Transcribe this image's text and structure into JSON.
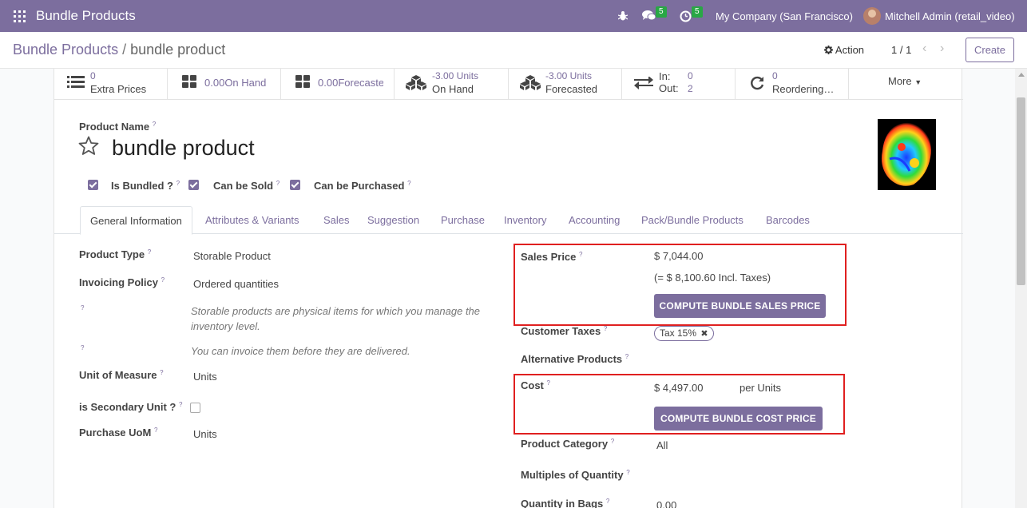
{
  "navbar": {
    "app_title": "Bundle Products",
    "chat_badge": "5",
    "activity_badge": "5",
    "company": "My Company (San Francisco)",
    "user": "Mitchell Admin (retail_video)"
  },
  "control": {
    "breadcrumb_parent": "Bundle Products",
    "breadcrumb_separator": "/",
    "breadcrumb_current": "bundle product",
    "action_label": "Action",
    "pager": "1 / 1",
    "create_label": "Create"
  },
  "smart_buttons": [
    {
      "value": "0",
      "label": "Extra Prices",
      "icon": "list-icon"
    },
    {
      "value": "0.00",
      "label": "On Hand",
      "icon": "grid-icon"
    },
    {
      "value": "0.00",
      "label": "Forecasted",
      "icon": "grid-icon"
    },
    {
      "value": "-3.00 Units",
      "label": "On Hand",
      "icon": "cubes-icon"
    },
    {
      "value": "-3.00 Units",
      "label": "Forecasted",
      "icon": "cubes-icon"
    },
    {
      "in_label": "In:",
      "in_value": "0",
      "out_label": "Out:",
      "out_value": "2",
      "icon": "exchange-icon"
    },
    {
      "value": "0",
      "label": "Reordering…",
      "icon": "refresh-icon"
    }
  ],
  "more_label": "More",
  "product": {
    "name_label": "Product Name",
    "name": "bundle product",
    "q": "?",
    "checkboxes": [
      {
        "label": "Is Bundled ?",
        "checked": true
      },
      {
        "label": "Can be Sold",
        "checked": true
      },
      {
        "label": "Can be Purchased",
        "checked": true
      }
    ]
  },
  "tabs": [
    "General Information",
    "Attributes & Variants",
    "Sales",
    "Suggestion",
    "Purchase",
    "Inventory",
    "Accounting",
    "Pack/Bundle Products",
    "Barcodes"
  ],
  "general": {
    "product_type_label": "Product Type",
    "product_type": "Storable Product",
    "invoicing_policy_label": "Invoicing Policy",
    "invoicing_policy": "Ordered quantities",
    "help_storable": "Storable products are physical items for which you manage the inventory level.",
    "help_invoice": "You can invoice them before they are delivered.",
    "uom_label": "Unit of Measure",
    "uom": "Units",
    "secondary_unit_label": "is Secondary Unit ?",
    "purchase_uom_label": "Purchase UoM",
    "purchase_uom": "Units",
    "sales_price_label": "Sales Price",
    "sales_price": "$ 7,044.00",
    "incl_taxes": "(= $ 8,100.60 Incl. Taxes)",
    "compute_sales_btn": "COMPUTE BUNDLE SALES PRICE",
    "customer_taxes_label": "Customer Taxes",
    "tax_tag": "Tax 15%",
    "alt_products_label": "Alternative Products",
    "cost_label": "Cost",
    "cost": "$ 4,497.00",
    "cost_per": "per Units",
    "compute_cost_btn": "COMPUTE BUNDLE COST PRICE",
    "category_label": "Product Category",
    "category": "All",
    "multiples_label": "Multiples of Quantity",
    "bags_label": "Quantity in Bags",
    "bags": "0.00"
  },
  "colors": {
    "brand": "#7c6e9e",
    "highlight": "#e02020"
  }
}
